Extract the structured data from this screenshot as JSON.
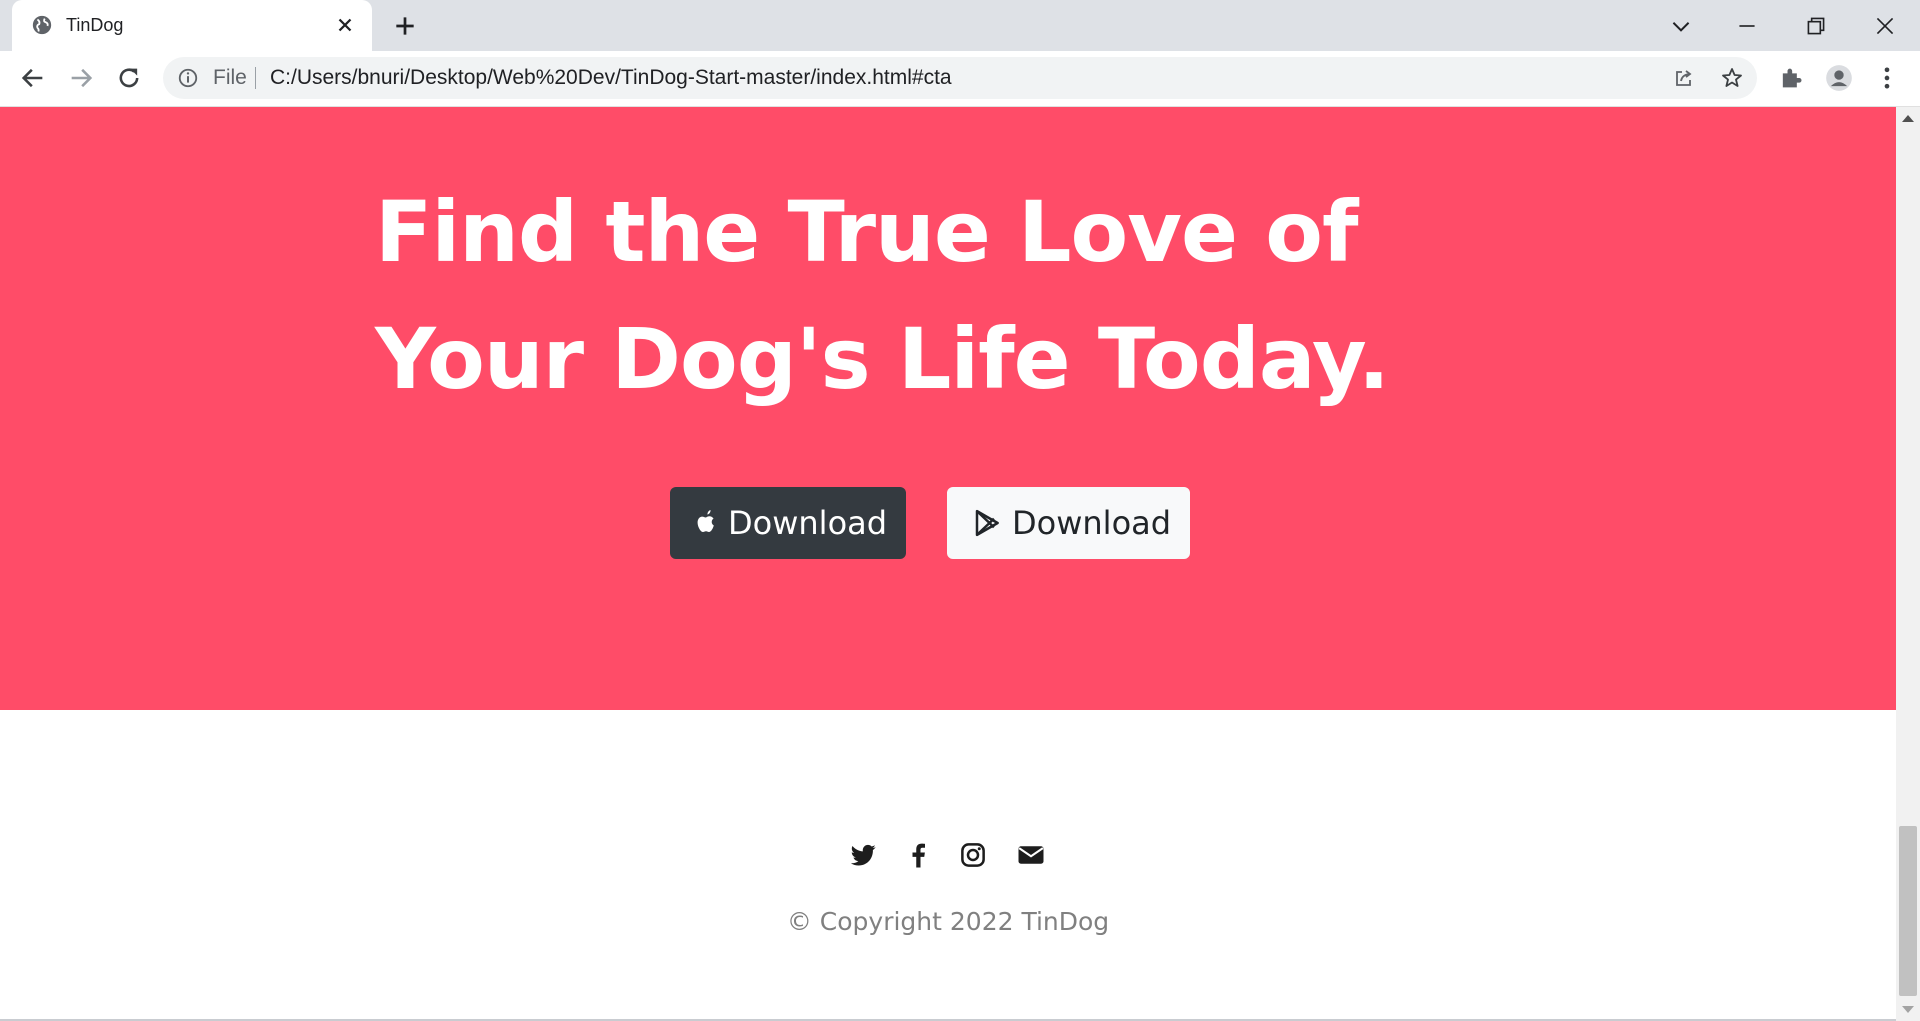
{
  "browser": {
    "tab_title": "TinDog",
    "address": {
      "scheme_label": "File",
      "url": "C:/Users/bnuri/Desktop/Web%20Dev/TinDog-Start-master/index.html#cta"
    }
  },
  "cta": {
    "heading": "Find the True Love of Your Dog's Life Today.",
    "background_color": "#ff4c68",
    "buttons": [
      {
        "label": "Download",
        "icon": "apple-icon",
        "style": "dark"
      },
      {
        "label": "Download",
        "icon": "google-play-icon",
        "style": "light"
      }
    ]
  },
  "footer": {
    "social_icons": [
      "twitter-icon",
      "facebook-icon",
      "instagram-icon",
      "envelope-icon"
    ],
    "copyright": "© Copyright 2022 TinDog"
  }
}
